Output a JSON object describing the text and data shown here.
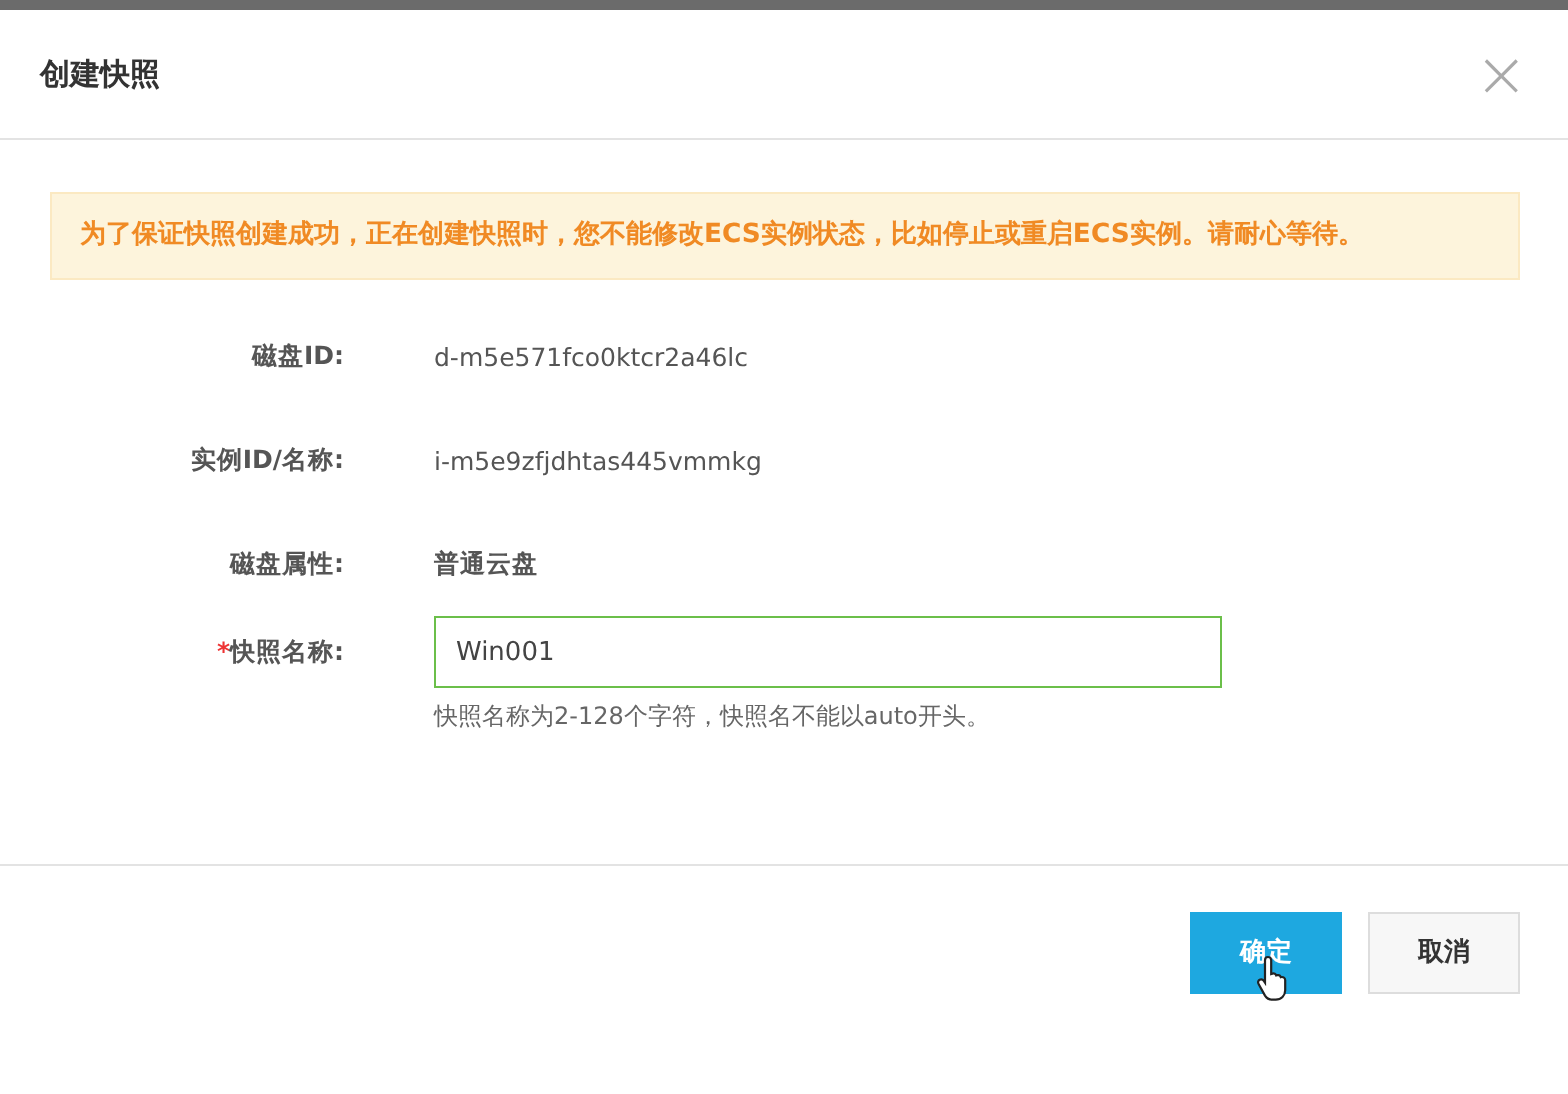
{
  "dialog": {
    "title": "创建快照",
    "close": "×"
  },
  "notice": "为了保证快照创建成功，正在创建快照时，您不能修改ECS实例状态，比如停止或重启ECS实例。请耐心等待。",
  "fields": [
    {
      "kind": "text",
      "label": "磁盘ID:",
      "value": "d-m5e571fco0ktcr2a46lc"
    },
    {
      "kind": "text",
      "label": "实例ID/名称:",
      "value": "i-m5e9zfjdhtas445vmmkg"
    },
    {
      "kind": "strong",
      "label": "磁盘属性:",
      "value": "普通云盘"
    },
    {
      "kind": "input",
      "label": "快照名称:",
      "value": "Win001",
      "required_mark": "*",
      "hint": "快照名称为2-128个字符，快照名不能以auto开头。"
    }
  ],
  "buttons": [
    {
      "label": "确定",
      "kind": "primary"
    },
    {
      "label": "取消",
      "kind": "default"
    }
  ]
}
